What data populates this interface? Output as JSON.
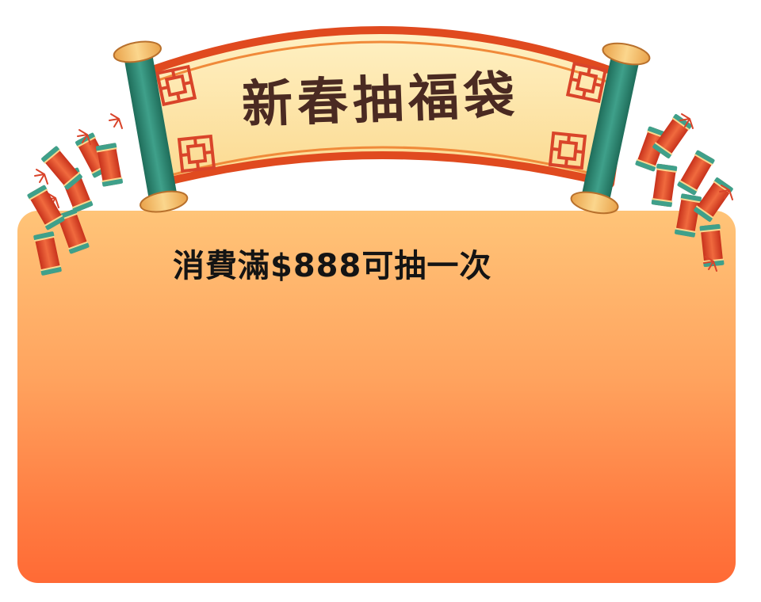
{
  "banner": {
    "title": "新春抽福袋"
  },
  "panel": {
    "subtitle": "消費滿$888可抽一次"
  },
  "colors": {
    "panel_top": "#ffc478",
    "panel_bottom": "#ff6a35",
    "scroll_paper": "#fde6a8",
    "scroll_border": "#e04a1f",
    "rod_green": "#2f8c74",
    "firecracker_red": "#e2462a",
    "firecracker_band": "#3fa08a",
    "title_color": "#4a2a22",
    "subtitle_color": "#141414"
  },
  "icons": [
    "scroll-banner",
    "left-firecrackers",
    "right-firecrackers"
  ]
}
